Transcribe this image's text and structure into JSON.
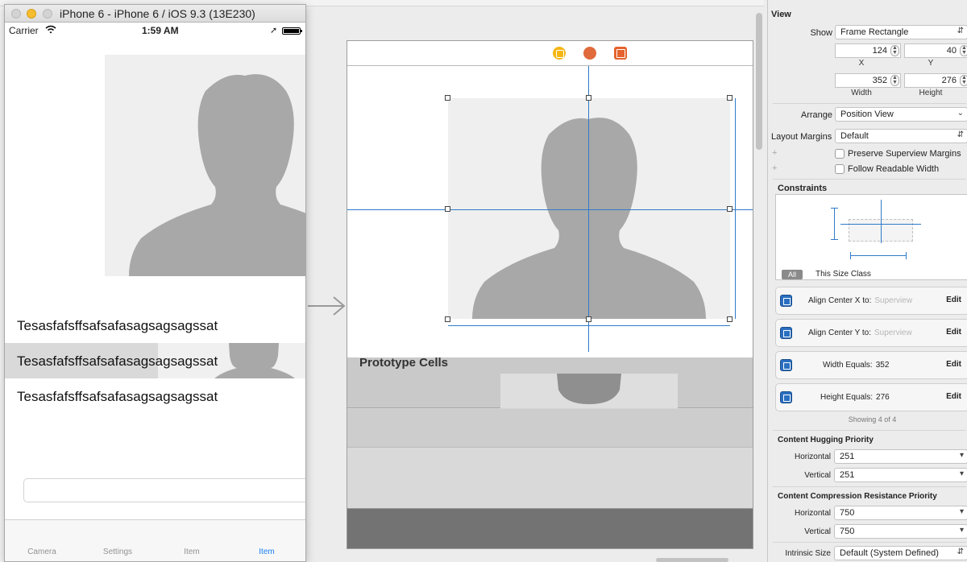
{
  "simulator": {
    "title": "iPhone 6 - iPhone 6 / iOS 9.3 (13E230)",
    "status": {
      "carrier": "Carrier",
      "time": "1:59 AM"
    },
    "rows": [
      "Tesasfafsffsafsafasagsagsagssat",
      "Tesasfafsffsafsafasagsagsagssat",
      "Tesasfafsffsafsafasagsagsagssat"
    ],
    "textfield_value": "",
    "tabs": [
      "Camera",
      "Settings",
      "Item",
      "Item"
    ],
    "selected_tab_index": 3
  },
  "storyboard": {
    "prototype_label": "Prototype Cells",
    "scene_icons": [
      "view-controller-icon",
      "first-responder-icon",
      "exit-icon"
    ]
  },
  "inspector": {
    "section_view": "View",
    "show_label": "Show",
    "show_value": "Frame Rectangle",
    "x_value": "124",
    "x_label": "X",
    "y_value": "40",
    "y_label": "Y",
    "width_value": "352",
    "width_label": "Width",
    "height_value": "276",
    "height_label": "Height",
    "arrange_label": "Arrange",
    "arrange_value": "Position View",
    "layout_margins_label": "Layout Margins",
    "layout_margins_value": "Default",
    "preserve_label": "Preserve Superview Margins",
    "follow_label": "Follow Readable Width",
    "constraints_title": "Constraints",
    "tab_all": "All",
    "tab_size_class": "This Size Class",
    "constraints": [
      {
        "text": "Align Center X to:",
        "target": "Superview",
        "edit": "Edit"
      },
      {
        "text": "Align Center Y to:",
        "target": "Superview",
        "edit": "Edit"
      },
      {
        "text": "Width Equals:",
        "target": "352",
        "edit": "Edit"
      },
      {
        "text": "Height Equals:",
        "target": "276",
        "edit": "Edit"
      }
    ],
    "showing": "Showing 4 of 4",
    "hugging_title": "Content Hugging Priority",
    "horizontal_label": "Horizontal",
    "vertical_label": "Vertical",
    "hugging_h": "251",
    "hugging_v": "251",
    "compression_title": "Content Compression Resistance Priority",
    "compression_h": "750",
    "compression_v": "750",
    "intrinsic_label": "Intrinsic Size",
    "intrinsic_value": "Default (System Defined)"
  },
  "colors": {
    "accent": "#2f7bc9",
    "tab_selected": "#1a7ef0",
    "silhouette": "#a8a8a8",
    "placeholder_bg": "#efefef"
  }
}
